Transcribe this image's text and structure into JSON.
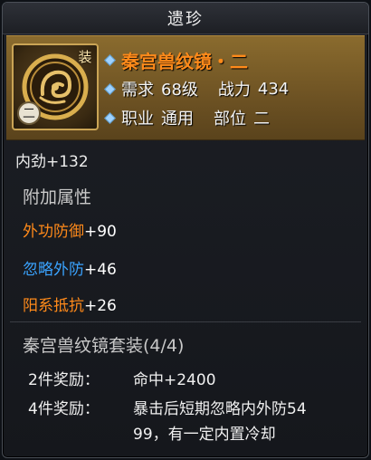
{
  "window": {
    "title": "遗珍"
  },
  "item": {
    "name": "秦宫兽纹镜・二",
    "equip_badge": "装",
    "tier_badge": "二",
    "icon": "bronze-mirror-icon",
    "req_label": "需求",
    "req_value": "68级",
    "power_label": "战力",
    "power_value": "434",
    "class_label": "职业",
    "class_value": "通用",
    "slot_label": "部位",
    "slot_value": "二"
  },
  "base_stat": "内劲+132",
  "extra": {
    "title": "附加属性",
    "attrs": [
      {
        "name": "外功防御",
        "value": "+90",
        "color": "#ff8a1a"
      },
      {
        "name": "忽略外防",
        "value": "+46",
        "color": "#3aa3ff"
      },
      {
        "name": "阳系抵抗",
        "value": "+26",
        "color": "#ff8a1a"
      }
    ]
  },
  "set": {
    "title": "秦宫兽纹镜套装(4/4)",
    "bonuses": [
      {
        "label": "2件奖励：",
        "effect": "命中+2400"
      },
      {
        "label": "4件奖励：",
        "effect_line1": "暴击后短期忽略内外防54",
        "effect_line2": "99，有一定内置冷却"
      }
    ]
  },
  "colors": {
    "orange": "#ff8a1a",
    "blue": "#3aa3ff",
    "gold": "#caa455"
  }
}
